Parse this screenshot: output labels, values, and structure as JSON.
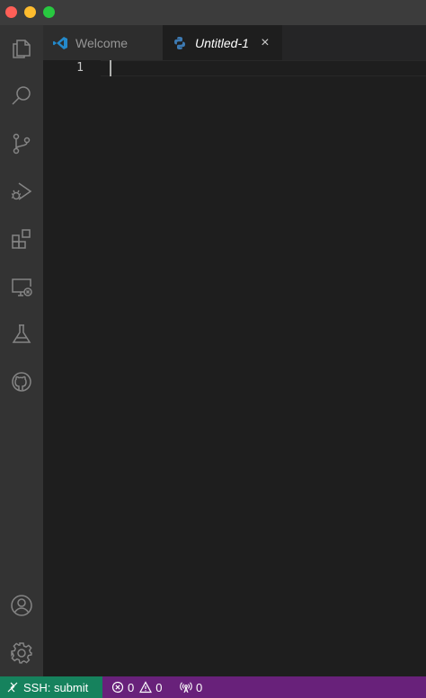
{
  "window": {
    "traffic_lights": [
      "close",
      "minimize",
      "maximize"
    ]
  },
  "activity_bar": {
    "items": [
      {
        "name": "explorer",
        "icon": "files-icon"
      },
      {
        "name": "search",
        "icon": "search-icon"
      },
      {
        "name": "source-control",
        "icon": "source-control-icon"
      },
      {
        "name": "run-and-debug",
        "icon": "run-debug-icon"
      },
      {
        "name": "extensions",
        "icon": "extensions-icon"
      },
      {
        "name": "remote-explorer",
        "icon": "remote-explorer-icon"
      },
      {
        "name": "testing",
        "icon": "flask-icon"
      },
      {
        "name": "github",
        "icon": "github-icon"
      }
    ],
    "bottom_items": [
      {
        "name": "accounts",
        "icon": "account-icon"
      },
      {
        "name": "manage",
        "icon": "gear-icon"
      }
    ]
  },
  "tabs": [
    {
      "label": "Welcome",
      "icon": "vscode-icon",
      "active": false
    },
    {
      "label": "Untitled-1",
      "icon": "python-icon",
      "active": true,
      "close": "×"
    }
  ],
  "editor": {
    "line_numbers": [
      "1"
    ],
    "content": ""
  },
  "status_bar": {
    "remote_label": "SSH: submit",
    "errors": "0",
    "warnings": "0",
    "ports": "0",
    "colors": {
      "background": "#68217a",
      "remote_background": "#16825d"
    }
  }
}
